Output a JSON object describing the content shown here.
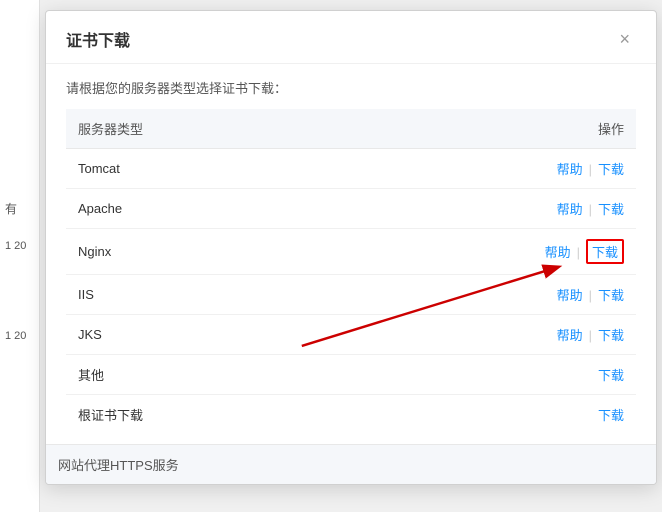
{
  "modal": {
    "title": "证书下载",
    "close_icon": "×",
    "description": "请根据您的服务器类型选择证书下载：",
    "table": {
      "col_server": "服务器类型",
      "col_operation": "操作",
      "rows": [
        {
          "id": "tomcat",
          "name": "Tomcat",
          "has_help": true,
          "has_download": true,
          "highlight_download": false
        },
        {
          "id": "apache",
          "name": "Apache",
          "has_help": true,
          "has_download": true,
          "highlight_download": false
        },
        {
          "id": "nginx",
          "name": "Nginx",
          "has_help": true,
          "has_download": true,
          "highlight_download": true
        },
        {
          "id": "iis",
          "name": "IIS",
          "has_help": true,
          "has_download": true,
          "highlight_download": false
        },
        {
          "id": "jks",
          "name": "JKS",
          "has_help": true,
          "has_download": true,
          "highlight_download": false
        },
        {
          "id": "other",
          "name": "其他",
          "has_help": false,
          "has_download": true,
          "highlight_download": false
        },
        {
          "id": "root",
          "name": "根证书下载",
          "has_help": false,
          "has_download": true,
          "highlight_download": false
        }
      ]
    },
    "footer_section": "网站代理HTTPS服务"
  },
  "labels": {
    "help": "帮助",
    "download": "下载"
  },
  "bg": {
    "text1": "有",
    "date1": "1\n20",
    "text2": "1\n20"
  }
}
